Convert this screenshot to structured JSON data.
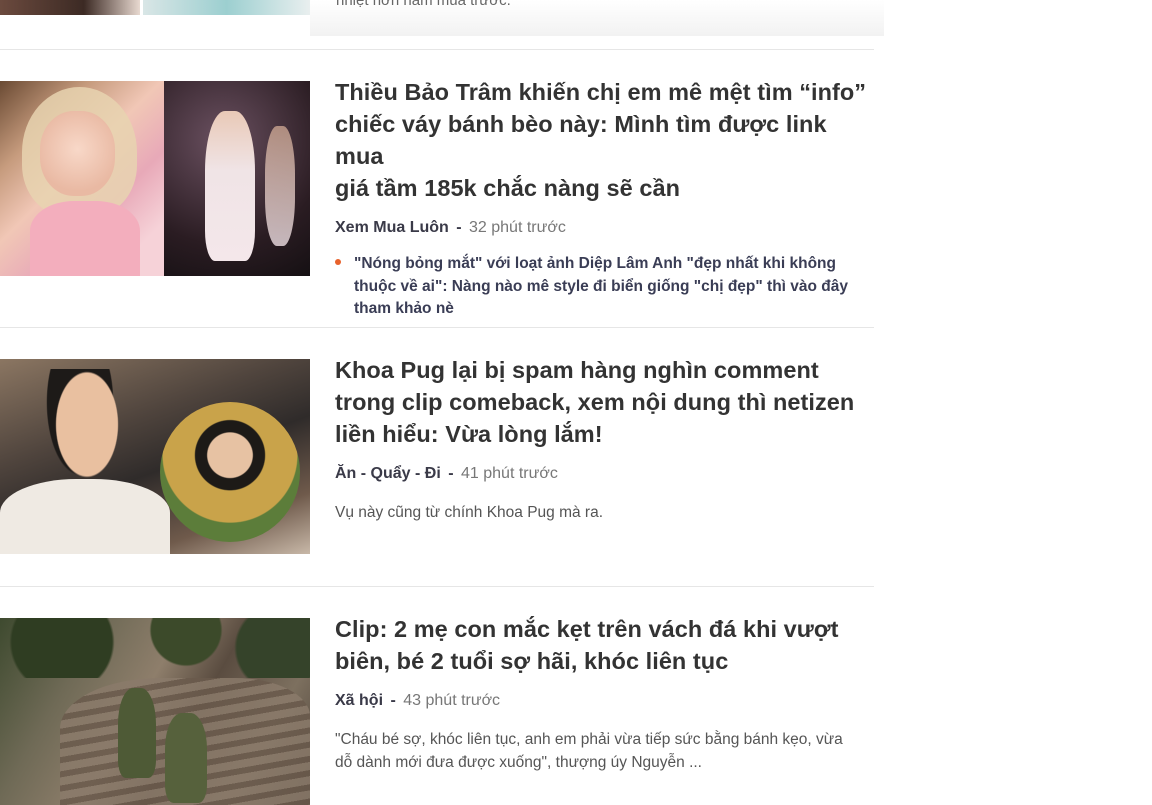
{
  "top_partial": {
    "cut_text": "nhiệt hơn năm mùa trước."
  },
  "articles": [
    {
      "title_lines": [
        "Thiều Bảo Trâm khiến chị em mê mệt tìm “info”",
        "chiếc váy bánh bèo này: Mình tìm được link mua",
        "giá tầm 185k chắc nàng sẽ cần"
      ],
      "category": "Xem Mua Luôn",
      "separator": "-",
      "time": "32 phút trước",
      "related_lines": [
        "\"Nóng bỏng mắt\" với loạt ảnh Diệp Lâm Anh \"đẹp nhất khi không",
        "thuộc về ai\": Nàng nào mê style đi biển giống \"chị đẹp\" thì vào đây",
        "tham khảo nè"
      ]
    },
    {
      "title_lines": [
        "Khoa Pug lại bị spam hàng nghìn comment",
        "trong clip comeback, xem nội dung thì netizen",
        "liền hiểu: Vừa lòng lắm!"
      ],
      "category": "Ăn - Quẩy - Đi",
      "separator": "-",
      "time": "41 phút trước",
      "sapo_lines": [
        "Vụ này cũng từ chính Khoa Pug mà ra."
      ]
    },
    {
      "title_lines": [
        "Clip: 2 mẹ con mắc kẹt trên vách đá khi vượt",
        "biên, bé 2 tuổi sợ hãi, khóc liên tục"
      ],
      "category": "Xã hội",
      "separator": "-",
      "time": "43 phút trước",
      "sapo_lines": [
        "\"Cháu bé sợ, khóc liên tục, anh em phải vừa tiếp sức bằng bánh kẹo, vừa",
        "dỗ dành mới đưa được xuống\", thượng úy Nguyễn ..."
      ]
    }
  ],
  "colors": {
    "accent_dot": "#e8622c",
    "title": "#333333",
    "divider": "#e6e6e6"
  }
}
